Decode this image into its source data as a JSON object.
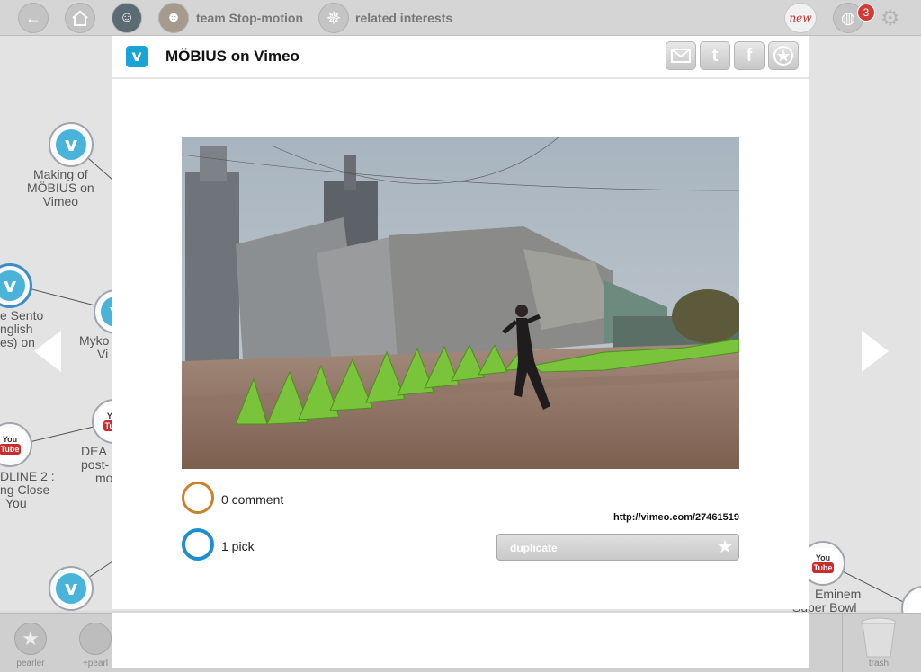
{
  "topbar": {
    "team_label": "team Stop-motion",
    "related_label": "related interests",
    "new_label": "new",
    "notification_count": "3"
  },
  "modal": {
    "title": "MÖBIUS on Vimeo",
    "logo": "v",
    "share_icons": [
      "mail-icon",
      "twitter-icon",
      "facebook-icon",
      "star-icon"
    ],
    "twitter_glyph": "t",
    "facebook_glyph": "f",
    "comments_label": "0 comment",
    "picks_label": "1 pick",
    "source_url": "http://vimeo.com/27461519",
    "duplicate_label": "duplicate",
    "comment_ring_color": "#c8822a",
    "pick_ring_color": "#1d8fcf"
  },
  "graph": {
    "nodes": [
      {
        "icon": "vimeo-icon",
        "label": [
          "Making of",
          "MÖBIUS on",
          "Vimeo"
        ]
      },
      {
        "icon": "vimeo-icon",
        "label": [
          "e Sento",
          "nglish",
          "es) on"
        ]
      },
      {
        "icon": "vimeo-icon",
        "label": [
          "Myko",
          "Vi"
        ]
      },
      {
        "icon": "youtube-icon",
        "label": [
          "DLINE 2 :",
          "ng Close",
          "You"
        ]
      },
      {
        "icon": "youtube-icon",
        "label": [
          "DEA",
          "post-",
          "mo"
        ]
      },
      {
        "icon": "vimeo-icon",
        "label": []
      },
      {
        "icon": "youtube-icon",
        "label": [
          "Eminem",
          "Super Bowl"
        ]
      }
    ],
    "youtube_you": "You",
    "youtube_tube": "Tube"
  },
  "bottombar": {
    "pearler_label": "pearler",
    "add_pearler_label": "+pearl",
    "trash_label": "trash"
  }
}
